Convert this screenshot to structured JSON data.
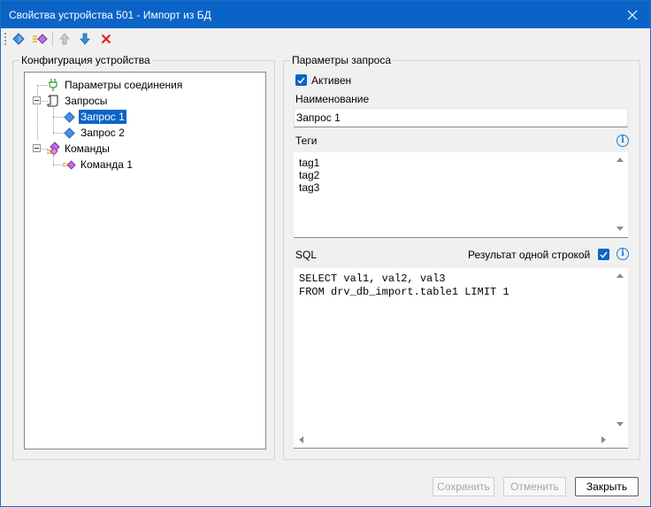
{
  "window": {
    "title": "Свойства устройства 501 - Импорт из БД"
  },
  "toolbar": {
    "items": [
      {
        "icon": "blue-diamond-icon"
      },
      {
        "icon": "purple-diamond-icon"
      },
      {
        "icon": "arrow-up-icon"
      },
      {
        "icon": "arrow-down-icon"
      },
      {
        "icon": "delete-x-icon"
      }
    ]
  },
  "config_panel": {
    "label": "Конфигурация устройства",
    "tree": [
      {
        "label": "Параметры соединения",
        "icon": "plug-icon"
      },
      {
        "label": "Запросы",
        "icon": "script-icon"
      },
      {
        "label": "Запрос 1",
        "icon": "blue-diamond-icon",
        "selected": true
      },
      {
        "label": "Запрос 2",
        "icon": "blue-diamond-icon"
      },
      {
        "label": "Команды",
        "icon": "commands-icon"
      },
      {
        "label": "Команда 1",
        "icon": "purple-diamond-icon"
      }
    ]
  },
  "query_panel": {
    "label": "Параметры запроса",
    "active": {
      "label": "Активен",
      "checked": true
    },
    "name": {
      "label": "Наименование",
      "value": "Запрос 1"
    },
    "tags": {
      "label": "Теги",
      "value": "tag1\ntag2\ntag3"
    },
    "sql": {
      "label": "SQL",
      "single_row": {
        "label": "Результат одной строкой",
        "checked": true
      },
      "value": "SELECT val1, val2, val3\nFROM drv_db_import.table1 LIMIT 1"
    }
  },
  "buttons": {
    "save": "Сохранить",
    "cancel": "Отменить",
    "close": "Закрыть"
  },
  "colors": {
    "titlebar": "#0a64c8",
    "selection": "#0a64c8",
    "checkbox": "#0a64c8",
    "info": "#1b7fd6"
  }
}
